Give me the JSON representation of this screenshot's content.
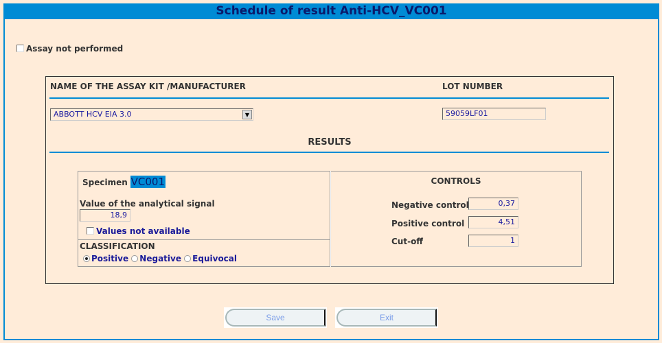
{
  "title": "Schedule of result Anti-HCV_VC001",
  "assay_not_performed": {
    "label": "Assay not performed",
    "checked": false
  },
  "kit": {
    "header": "NAME OF THE ASSAY KIT /MANUFACTURER",
    "selected": "ABBOTT HCV EIA 3.0"
  },
  "lot": {
    "header": "LOT NUMBER",
    "value": "59059LF01"
  },
  "results_header": "RESULTS",
  "specimen": {
    "label": "Specimen",
    "id": "VC001",
    "signal_label": "Value of the analytical signal",
    "signal_value": "18,9",
    "na_label": "Values not available",
    "na_checked": false
  },
  "classification": {
    "label": "CLASSIFICATION",
    "options": [
      "Positive",
      "Negative",
      "Equivocal"
    ],
    "selected": "Positive"
  },
  "controls": {
    "header": "CONTROLS",
    "negative_label": "Negative control",
    "negative_value": "0,37",
    "positive_label": "Positive control",
    "positive_value": "4,51",
    "cutoff_label": "Cut-off",
    "cutoff_value": "1"
  },
  "buttons": {
    "save": "Save",
    "exit": "Exit"
  },
  "colors": {
    "accent": "#008bd5",
    "background": "#ffecd9",
    "title_text": "#0a1a6b"
  }
}
